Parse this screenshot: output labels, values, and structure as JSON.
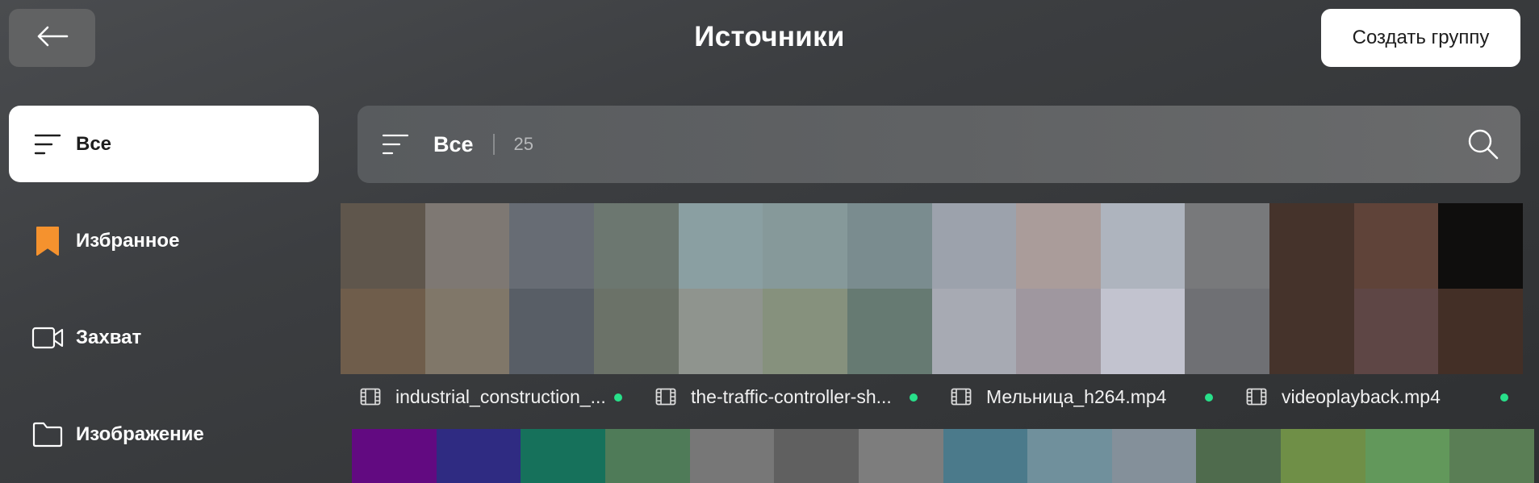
{
  "header": {
    "back_icon": "arrow-left-icon",
    "title": "Источники",
    "create_group_label": "Создать группу"
  },
  "sidebar": {
    "items": [
      {
        "label": "Все",
        "icon": "list-filter-icon",
        "active": true
      },
      {
        "label": "Избранное",
        "icon": "bookmark-icon",
        "accent": "#f5922e"
      },
      {
        "label": "Захват",
        "icon": "video-camera-icon"
      },
      {
        "label": "Изображение",
        "icon": "folder-icon"
      }
    ]
  },
  "filter": {
    "label": "Все",
    "count": "25",
    "search_icon": "search-icon"
  },
  "sources": [
    {
      "name": "industrial_construction_...",
      "status_color": "#28e08a"
    },
    {
      "name": "the-traffic-controller-sh...",
      "status_color": "#28e08a"
    },
    {
      "name": "Мельница_h264.mp4",
      "status_color": "#28e08a"
    },
    {
      "name": "videoplayback.mp4",
      "status_color": "#28e08a"
    }
  ],
  "thumbnails_row1": {
    "top": [
      "#5f564c",
      "#7e7873",
      "#676c74",
      "#6c7770",
      "#8a9fa2",
      "#86999a",
      "#7a8c8f",
      "#9ca2ac",
      "#aa9c9a",
      "#aeb4be",
      "#78797b",
      "#45332b",
      "#5f4339",
      "#0f0e0d"
    ],
    "bottom": [
      "#6f5d4b",
      "#807769",
      "#585e66",
      "#6b7268",
      "#8f948e",
      "#86917d",
      "#667a72",
      "#a7aab3",
      "#9f979f",
      "#c2c3cf",
      "#6f7074",
      "#45332b",
      "#5e4645",
      "#432f26"
    ]
  },
  "thumbnails_row2": [
    "#620a81",
    "#2f2b82",
    "#16715b",
    "#4f7b58",
    "#777777",
    "#606060",
    "#7d7d7d",
    "#4b7a8b",
    "#70909c",
    "#84909a",
    "#4f6b4d",
    "#6f8f47",
    "#62985b",
    "#5a7e55"
  ]
}
